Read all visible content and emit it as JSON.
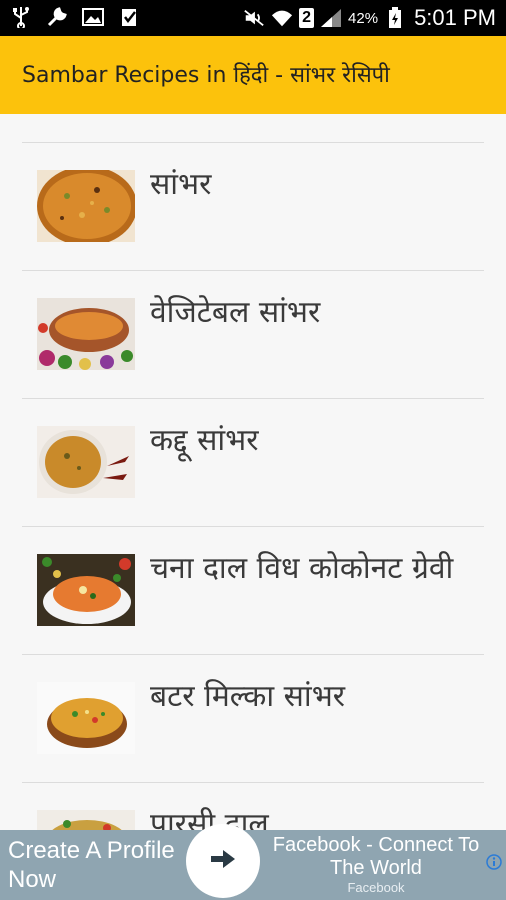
{
  "status_bar": {
    "battery_percent": "42%",
    "time": "5:01 PM",
    "sim_label": "2",
    "icons": [
      "usb-icon",
      "wrench-icon",
      "image-icon",
      "clipboard-check-icon",
      "mute-icon",
      "wifi-icon",
      "signal-icon",
      "battery-icon"
    ]
  },
  "app_bar": {
    "title": "Sambar Recipes in हिंदी - सांभर रेसिपी",
    "color": "#fcc20c"
  },
  "recipes": [
    {
      "title": "सांभर",
      "image": "sambar-bowl-image"
    },
    {
      "title": "वेजिटेबल सांभर",
      "image": "vegetable-sambar-image"
    },
    {
      "title": "कद्दू सांभर",
      "image": "pumpkin-sambar-image"
    },
    {
      "title": "चना दाल विध कोकोनट ग्रेवी",
      "image": "chana-dal-image"
    },
    {
      "title": "बटर मिल्का सांभर",
      "image": "buttermilk-sambar-image"
    },
    {
      "title": "पारसी दाल",
      "image": "parsi-dal-image"
    }
  ],
  "ad": {
    "cta": "Create A Profile Now",
    "headline": "Facebook - Connect To The World",
    "advertiser": "Facebook",
    "icons": [
      "arrow-right-icon",
      "info-icon"
    ],
    "color": "#8fa5b1"
  }
}
